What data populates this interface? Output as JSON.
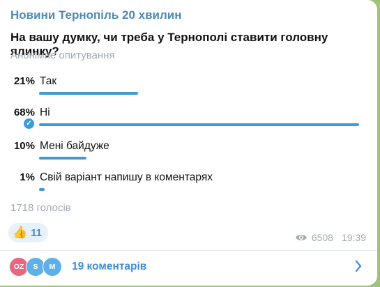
{
  "message": {
    "channel_name": "Новини Тернопіль 20 хвилин",
    "question": "На вашу думку, чи треба у Тернополі ставити головну ялинку?",
    "poll_type": "Анонімне опитування",
    "options": [
      {
        "percent_label": "21%",
        "label": "Так",
        "percent": 21,
        "voted": false
      },
      {
        "percent_label": "68%",
        "label": "Ні",
        "percent": 68,
        "voted": true
      },
      {
        "percent_label": "10%",
        "label": "Мені байдуже",
        "percent": 10,
        "voted": false
      },
      {
        "percent_label": "1%",
        "label": "Свій варіант напишу в коментарях",
        "percent": 1,
        "voted": false
      }
    ],
    "votes_label": "1718 голосів",
    "reaction": {
      "emoji": "👍",
      "count": "11"
    },
    "views": "6508",
    "time": "19:39",
    "comments": {
      "avatars": [
        {
          "initials": "OZ",
          "color": "#e8667f"
        },
        {
          "initials": "S",
          "color": "#5fb0e8"
        },
        {
          "initials": "M",
          "color": "#5fb0e8"
        }
      ],
      "label": "19 коментарів"
    }
  },
  "colors": {
    "accent": "#3d9bd6",
    "channel_name": "#4b8ab7",
    "secondary_text": "#a3aab1",
    "background": "#9ec27d"
  },
  "icons": {
    "vote_check": "check-icon",
    "views": "eye-icon",
    "comments_arrow": "chevron-right-icon"
  }
}
